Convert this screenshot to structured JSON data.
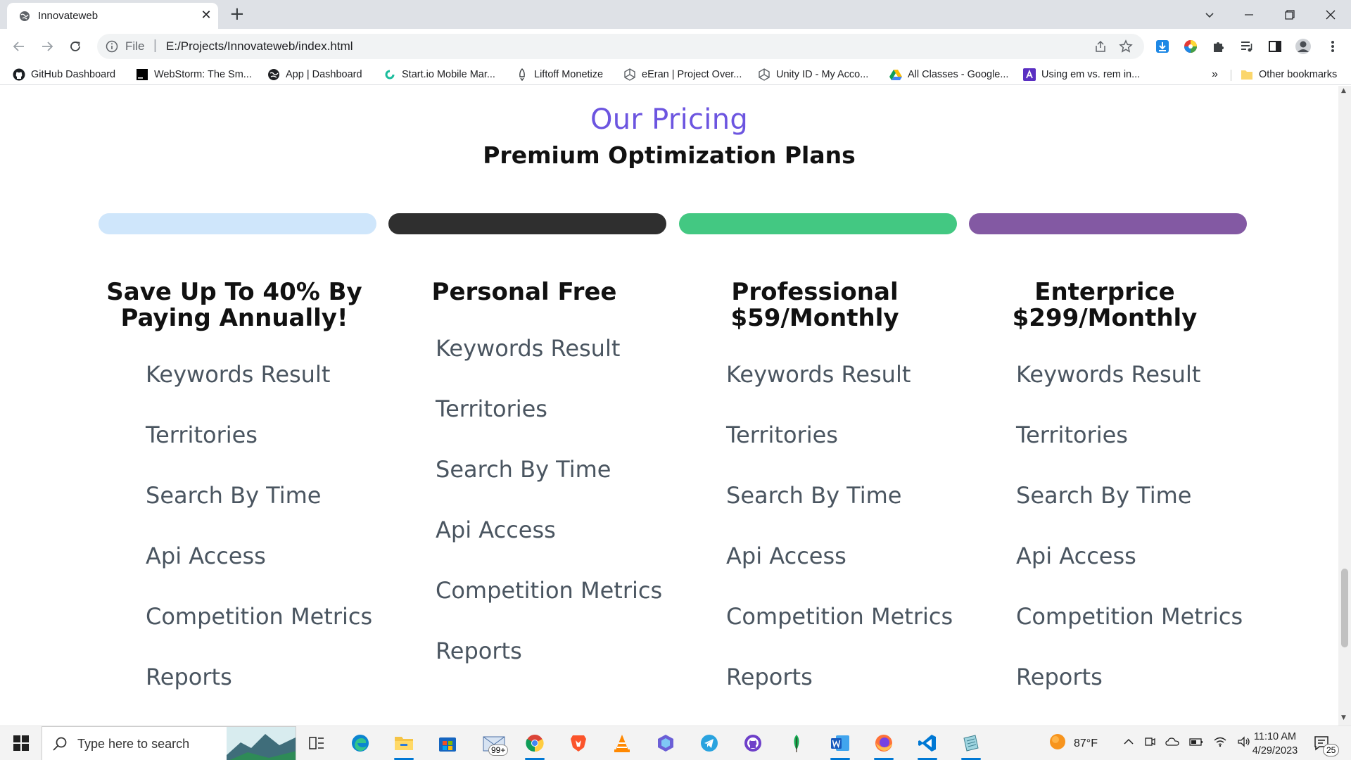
{
  "browser": {
    "tab_title": "Innovateweb",
    "tab_close_glyph": "✕",
    "new_tab_glyph": "+",
    "scheme_label": "File",
    "url": "E:/Projects/Innovateweb/index.html"
  },
  "bookmarks": [
    {
      "label": "GitHub Dashboard",
      "icon": "github-icon"
    },
    {
      "label": "WebStorm: The Sm...",
      "icon": "webstorm-icon"
    },
    {
      "label": "App | Dashboard",
      "icon": "globe-icon"
    },
    {
      "label": "Start.io Mobile Mar...",
      "icon": "startio-icon"
    },
    {
      "label": "Liftoff Monetize",
      "icon": "rocket-icon"
    },
    {
      "label": "eEran | Project Over...",
      "icon": "unity-icon"
    },
    {
      "label": "Unity ID - My Acco...",
      "icon": "unity-icon"
    },
    {
      "label": "All Classes - Google...",
      "icon": "google-drive-icon"
    },
    {
      "label": "Using em vs. rem in...",
      "icon": "letter-a-icon"
    }
  ],
  "bookmarks_more": "»",
  "other_bookmarks": "Other bookmarks",
  "page": {
    "kicker": "Our Pricing",
    "heading": "Premium Optimization Plans",
    "bar_colors": [
      "#cfe6fb",
      "#2f2f2f",
      "#43c882",
      "#8359a3"
    ],
    "plans": [
      {
        "title_thin": "Save ",
        "title_bold": "Up To 40% By Paying Annually!",
        "features": [
          "Keywords Result",
          "Territories",
          "Search By Time",
          "Api Access",
          "Competition Metrics",
          "Reports"
        ]
      },
      {
        "title_thin": "",
        "title_bold": "Personal Free",
        "features": [
          "Keywords Result",
          "Territories",
          "Search By Time",
          "Api Access",
          "Competition Metrics",
          "Reports"
        ]
      },
      {
        "title_thin": "",
        "title_bold": "Professional $59/Monthly",
        "features": [
          "Keywords Result",
          "Territories",
          "Search By Time",
          "Api Access",
          "Competition Metrics",
          "Reports"
        ]
      },
      {
        "title_thin": "",
        "title_bold": "Enterprice $299/Monthly",
        "features": [
          "Keywords Result",
          "Territories",
          "Search By Time",
          "Api Access",
          "Competition Metrics",
          "Reports"
        ]
      }
    ]
  },
  "taskbar": {
    "search_placeholder": "Type here to search",
    "mail_badge": "99+",
    "weather": "87°F",
    "time": "11:10 AM",
    "date": "4/29/2023",
    "notifications": "25"
  }
}
